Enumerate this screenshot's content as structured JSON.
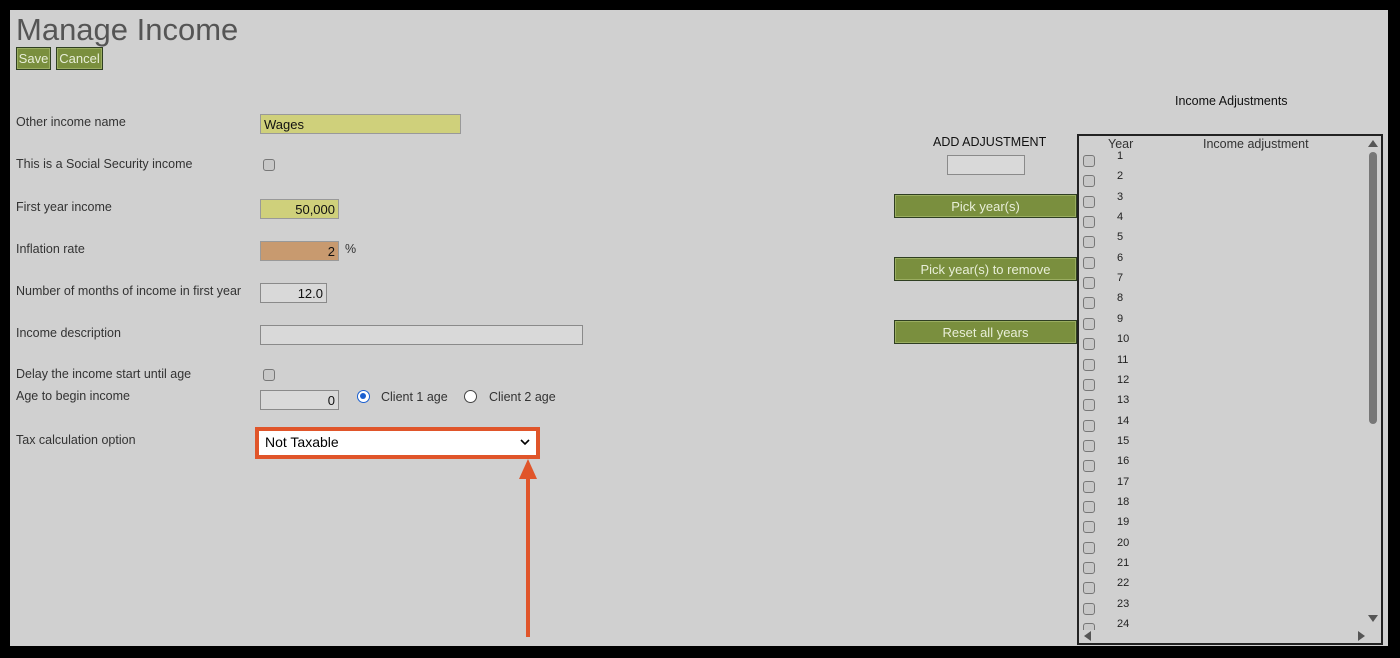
{
  "page": {
    "title": "Manage Income"
  },
  "toolbar": {
    "save_label": "Save",
    "cancel_label": "Cancel"
  },
  "form": {
    "other_income_name_label": "Other income name",
    "other_income_name_value": "Wages",
    "social_security_label": "This is a Social Security income",
    "social_security_checked": false,
    "first_year_income_label": "First year income",
    "first_year_income_value": "50,000",
    "inflation_rate_label": "Inflation rate",
    "inflation_rate_value": "2",
    "inflation_rate_unit": "%",
    "months_label": "Number of months of income in first year",
    "months_value": "12.0",
    "description_label": "Income description",
    "description_value": "",
    "delay_label": "Delay the income start until age",
    "delay_checked": false,
    "age_label": "Age to begin income",
    "age_value": "0",
    "client1_label": "Client 1 age",
    "client2_label": "Client 2 age",
    "selected_client": "client1",
    "tax_label": "Tax calculation option",
    "tax_value": "Not Taxable"
  },
  "adjustments": {
    "section_title": "Income Adjustments",
    "add_label": "ADD ADJUSTMENT",
    "add_value": "",
    "pick_years_label": "Pick year(s)",
    "pick_remove_label": "Pick year(s) to remove",
    "reset_label": "Reset all years",
    "col_year": "Year",
    "col_adjustment": "Income adjustment",
    "years": [
      "1",
      "2",
      "3",
      "4",
      "5",
      "6",
      "7",
      "8",
      "9",
      "10",
      "11",
      "12",
      "13",
      "14",
      "15",
      "16",
      "17",
      "18",
      "19",
      "20",
      "21",
      "22",
      "23",
      "24"
    ]
  },
  "annotation": {
    "highlight_color": "#e0552a"
  },
  "icons": {
    "dropdown": "chevron-down-icon",
    "arrow": "annotation-arrow-up"
  }
}
